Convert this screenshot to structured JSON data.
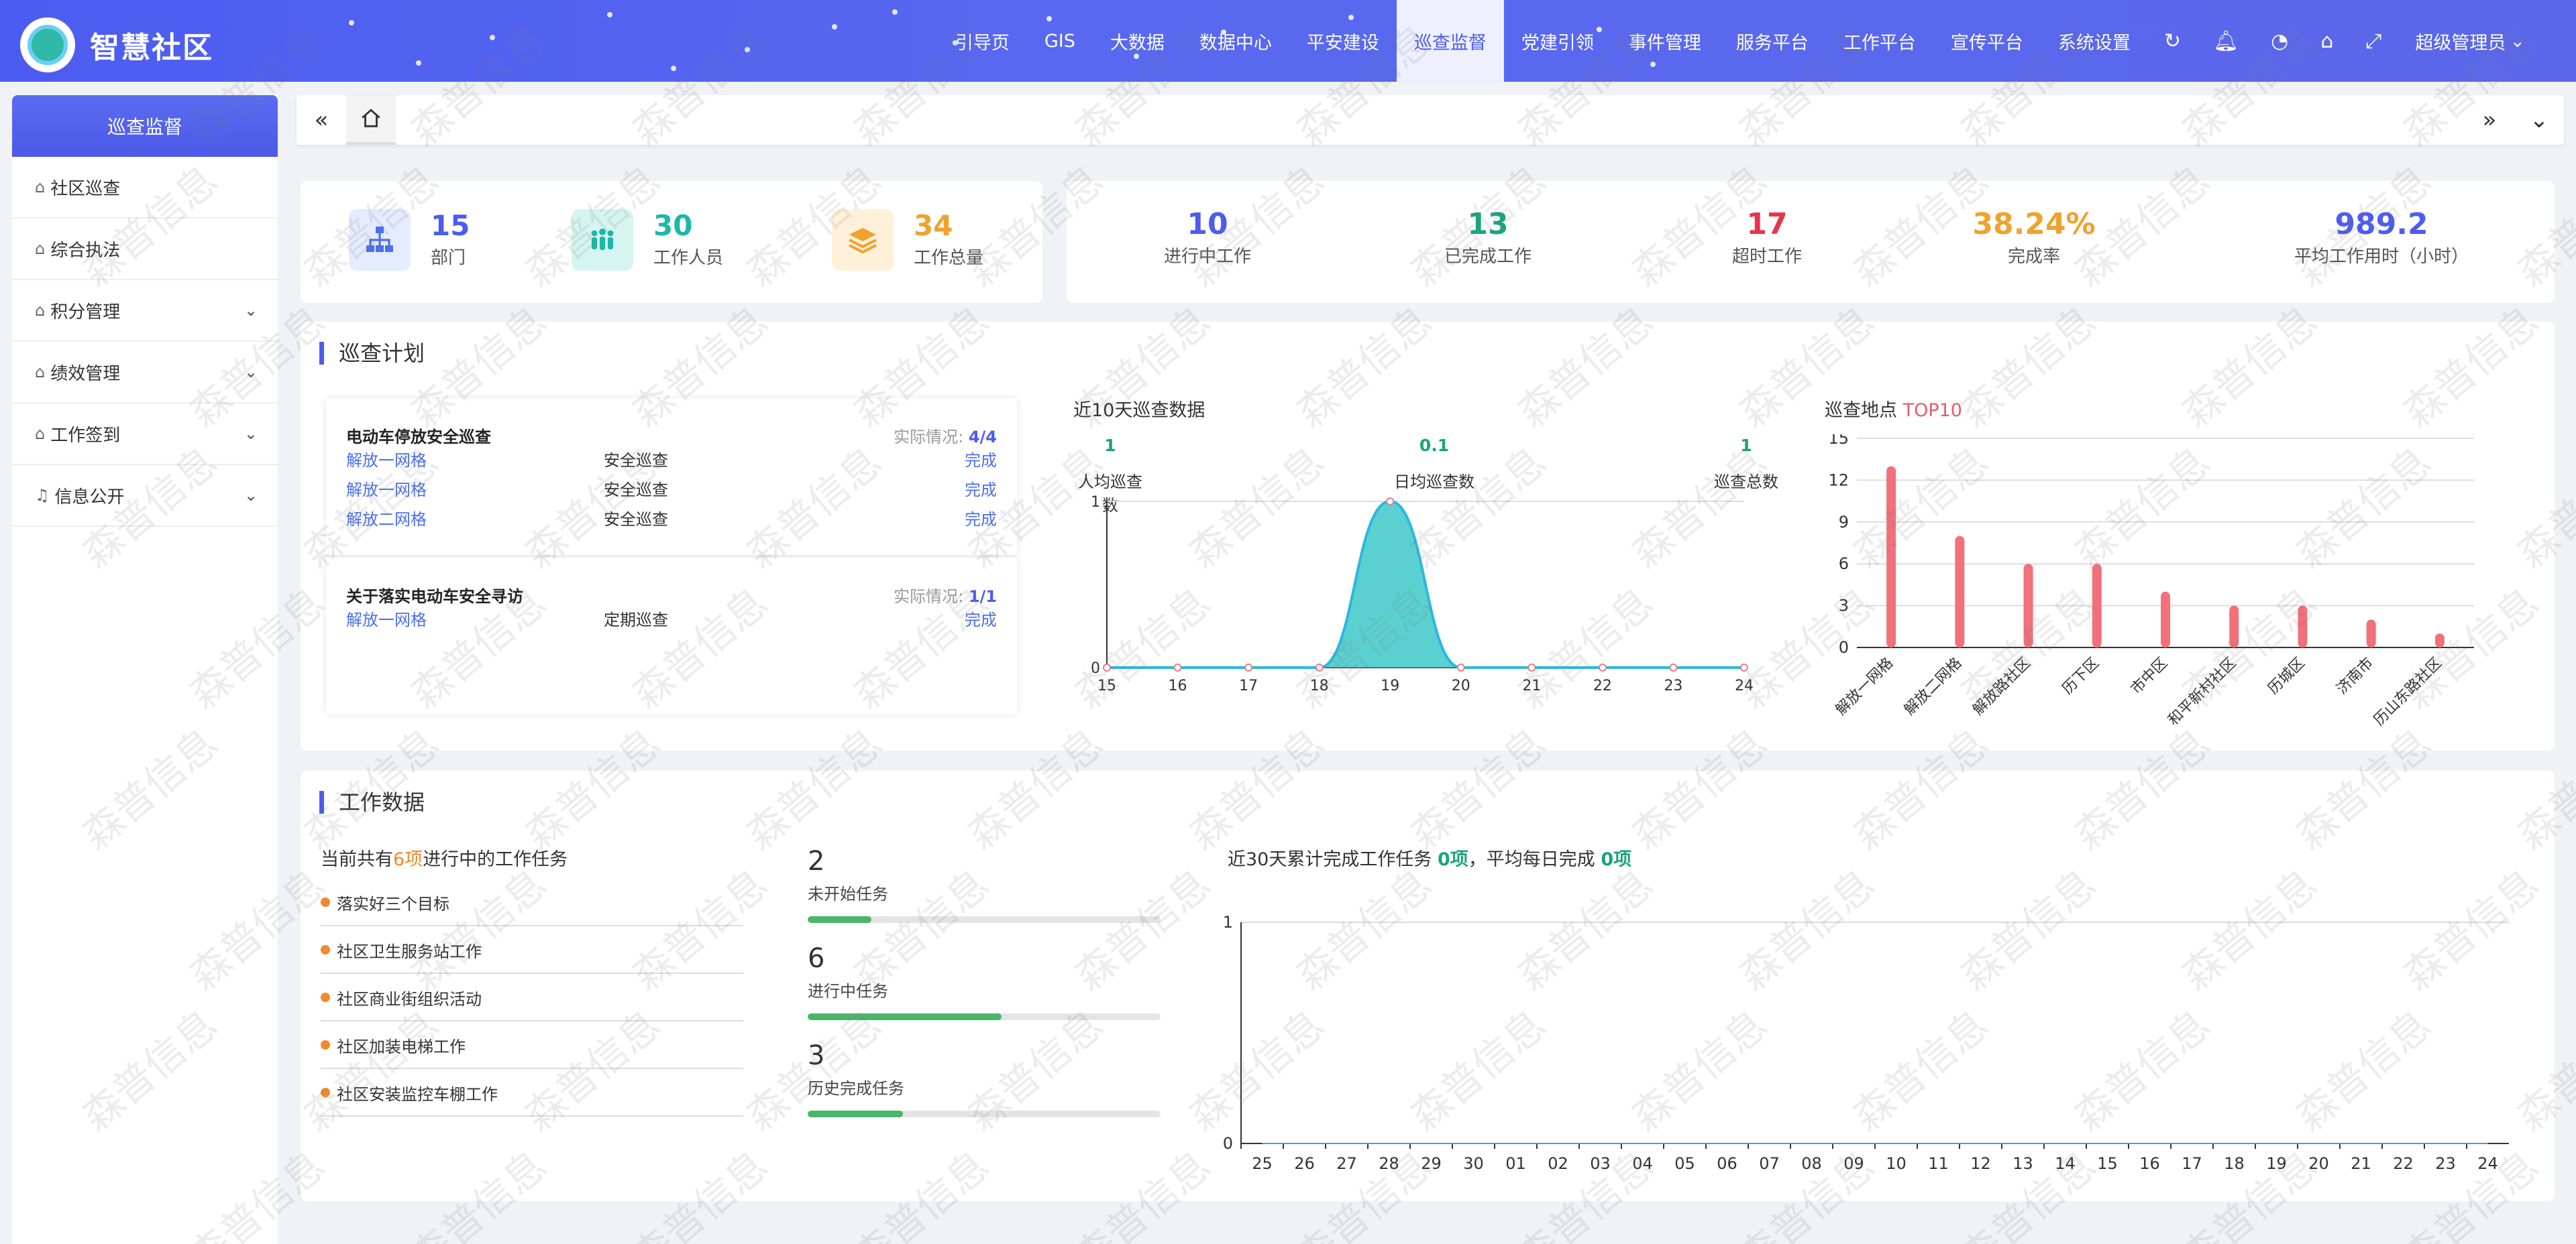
{
  "app": {
    "title": "智慧社区",
    "brand_color": "#4c5cf0"
  },
  "nav": {
    "items": [
      "引导页",
      "GIS",
      "大数据",
      "数据中心",
      "平安建设",
      "巡查监督",
      "党建引领",
      "事件管理",
      "服务平台",
      "工作平台",
      "宣传平台",
      "系统设置"
    ],
    "active": "巡查监督",
    "icons": [
      "refresh-icon",
      "bell-icon",
      "dashboard-icon",
      "tag-icon",
      "fullscreen-icon"
    ],
    "user": "超级管理员"
  },
  "sidebar": {
    "title": "巡查监督",
    "items": [
      {
        "label": "社区巡查",
        "expandable": false
      },
      {
        "label": "综合执法",
        "expandable": false
      },
      {
        "label": "积分管理",
        "expandable": true
      },
      {
        "label": "绩效管理",
        "expandable": true
      },
      {
        "label": "工作签到",
        "expandable": true
      },
      {
        "label": "信息公开",
        "expandable": true
      }
    ]
  },
  "stats_left": [
    {
      "num": "15",
      "label": "部门",
      "color": "#4c5cf0"
    },
    {
      "num": "30",
      "label": "工作人员",
      "color": "#1ab8a8"
    },
    {
      "num": "34",
      "label": "工作总量",
      "color": "#f0a22e"
    }
  ],
  "stats_right": [
    {
      "num": "10",
      "label": "进行中工作",
      "color": "#4c5cf0"
    },
    {
      "num": "13",
      "label": "已完成工作",
      "color": "#1aa57a"
    },
    {
      "num": "17",
      "label": "超时工作",
      "color": "#e8334a"
    },
    {
      "num": "38.24%",
      "label": "完成率",
      "color": "#f0a22e"
    },
    {
      "num": "989.2",
      "label": "平均工作用时（小时）",
      "color": "#4c5cf0"
    }
  ],
  "plan": {
    "title": "巡查计划",
    "groups": [
      {
        "name": "电动车停放安全巡查",
        "status_label": "实际情况:",
        "status": "4/4",
        "rows": [
          [
            "解放一网格",
            "安全巡查",
            "完成"
          ],
          [
            "解放一网格",
            "安全巡查",
            "完成"
          ],
          [
            "解放二网格",
            "安全巡查",
            "完成"
          ]
        ]
      },
      {
        "name": "关于落实电动车安全寻访",
        "status_label": "实际情况:",
        "status": "1/1",
        "rows": [
          [
            "解放一网格",
            "定期巡查",
            "完成"
          ]
        ]
      }
    ]
  },
  "ten_day": {
    "title": "近10天巡查数据",
    "kpis": [
      {
        "value": "1",
        "label": "人均巡查数"
      },
      {
        "value": "0.1",
        "label": "日均巡查数"
      },
      {
        "value": "1",
        "label": "巡查总数"
      }
    ]
  },
  "top10": {
    "title_prefix": "巡查地点",
    "title_highlight": "TOP10"
  },
  "chart_data": [
    {
      "type": "area",
      "x": [
        "15",
        "16",
        "17",
        "18",
        "19",
        "20",
        "21",
        "22",
        "23",
        "24"
      ],
      "values": [
        0,
        0,
        0,
        0,
        1,
        0,
        0,
        0,
        0,
        0
      ],
      "ylim": [
        0,
        1
      ],
      "yticks": [
        "0",
        "1"
      ]
    },
    {
      "type": "bar",
      "categories": [
        "解放一网格",
        "解放二网格",
        "解放路社区",
        "历下区",
        "市中区",
        "和平新村社区",
        "历城区",
        "济南市",
        "历山东路社区"
      ],
      "values": [
        13,
        8,
        6,
        6,
        4,
        3,
        3,
        2,
        1
      ],
      "ylim": [
        0,
        15
      ],
      "yticks": [
        "0",
        "3",
        "6",
        "9",
        "12",
        "15"
      ]
    },
    {
      "type": "line",
      "x": [
        "25",
        "26",
        "27",
        "28",
        "29",
        "30",
        "01",
        "02",
        "03",
        "04",
        "05",
        "06",
        "07",
        "08",
        "09",
        "10",
        "11",
        "12",
        "13",
        "14",
        "15",
        "16",
        "17",
        "18",
        "19",
        "20",
        "21",
        "22",
        "23",
        "24"
      ],
      "values": [
        0,
        0,
        0,
        0,
        0,
        0,
        0,
        0,
        0,
        0,
        0,
        0,
        0,
        0,
        0,
        0,
        0,
        0,
        0,
        0,
        0,
        0,
        0,
        0,
        0,
        0,
        0,
        0,
        0,
        0
      ],
      "ylim": [
        0,
        1
      ],
      "yticks": [
        "0",
        "1"
      ]
    }
  ],
  "work": {
    "title": "工作数据",
    "sub_prefix": "当前共有",
    "sub_count": "6项",
    "sub_suffix": "进行中的工作任务",
    "tasks": [
      "落实好三个目标",
      "社区卫生服务站工作",
      "社区商业街组织活动",
      "社区加装电梯工作",
      "社区安装监控车棚工作"
    ],
    "progress": [
      {
        "num": "2",
        "label": "未开始任务",
        "fraction": 0.18
      },
      {
        "num": "6",
        "label": "进行中任务",
        "fraction": 0.55
      },
      {
        "num": "3",
        "label": "历史完成任务",
        "fraction": 0.27
      }
    ],
    "month_prefix": "近30天累计完成工作任务",
    "month_count": "0项",
    "month_mid": "，平均每日完成",
    "month_avg": "0项"
  },
  "watermark": "森普信息"
}
